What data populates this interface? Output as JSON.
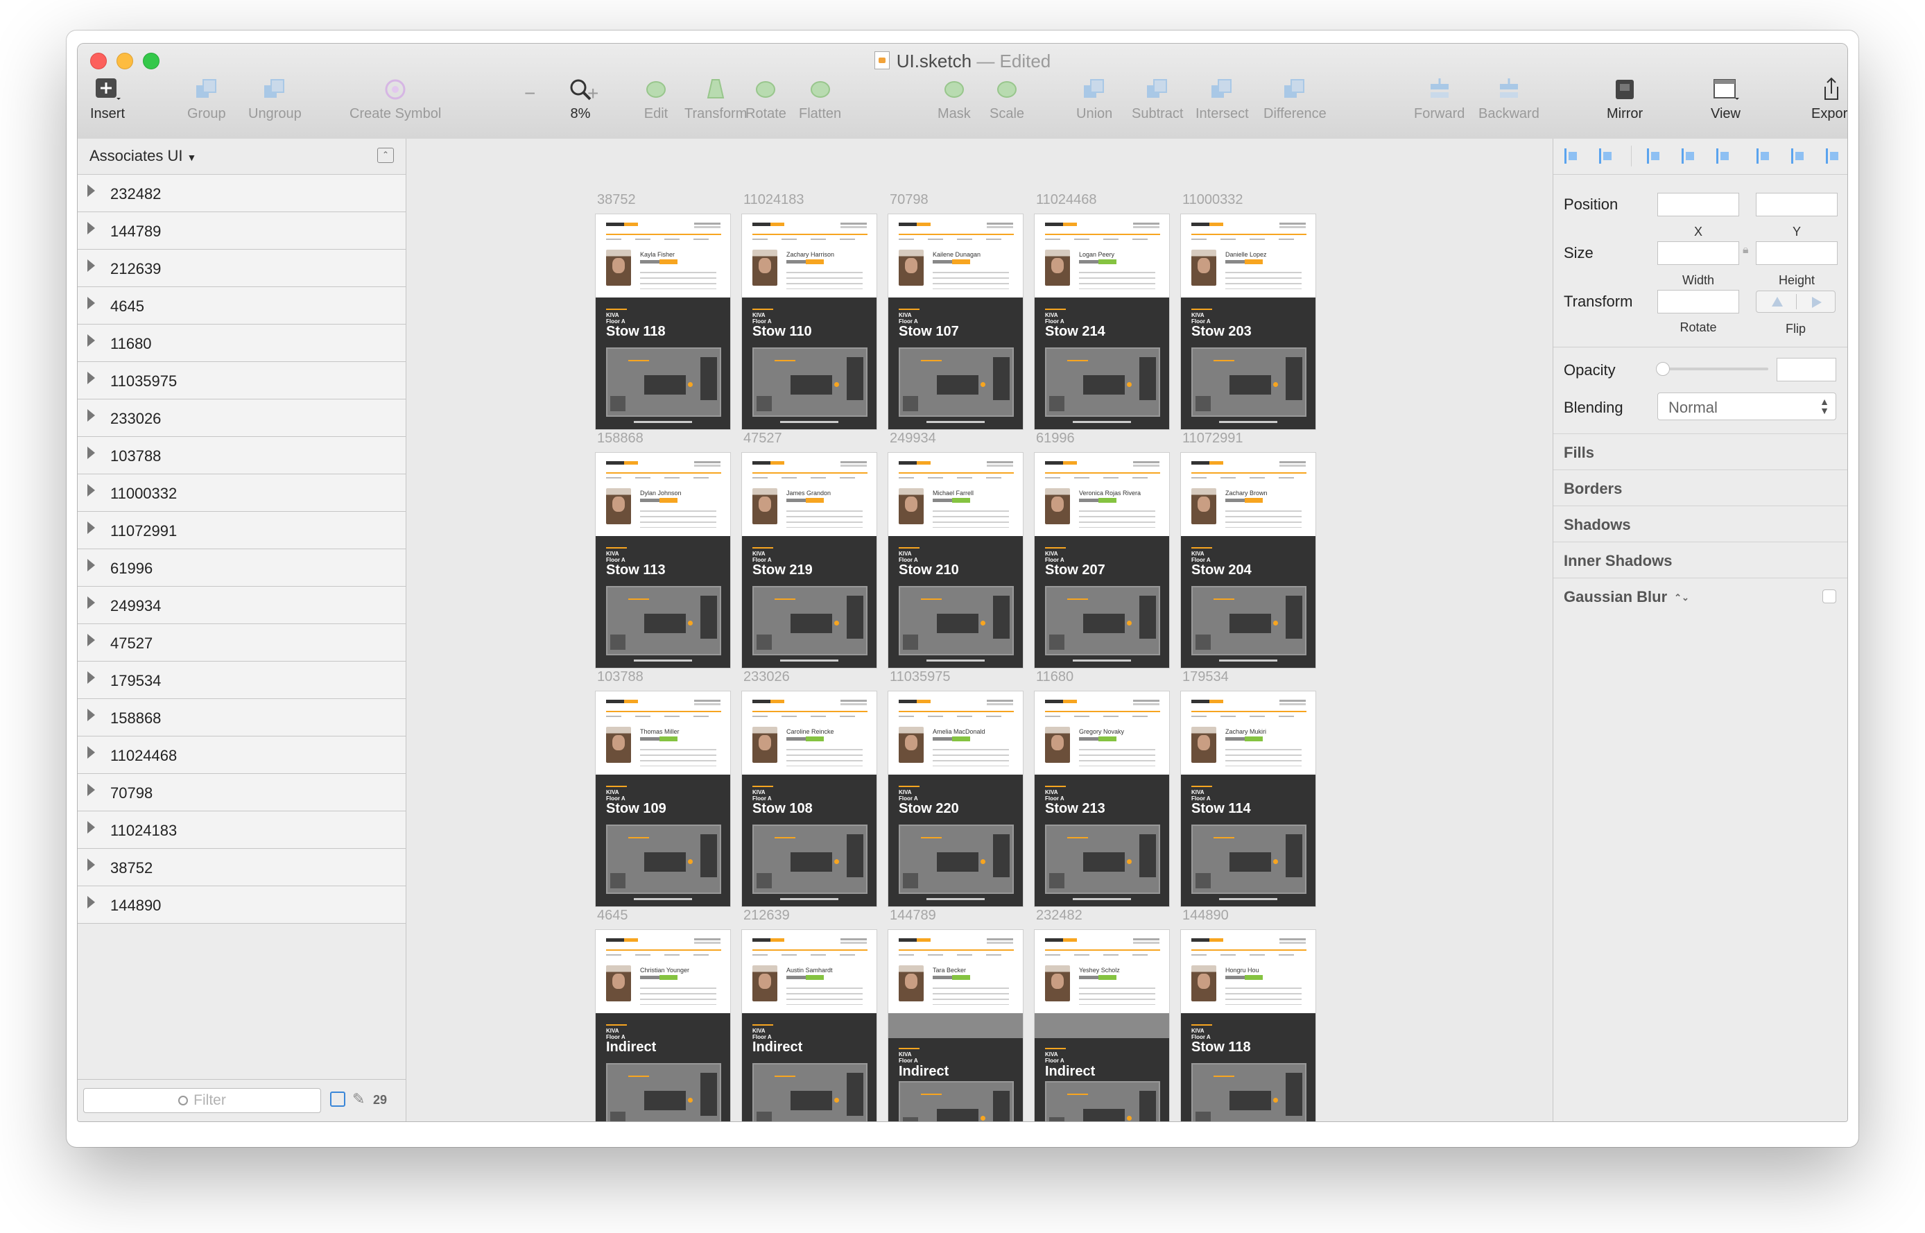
{
  "window": {
    "title": "UI.sketch",
    "title_separator": "—",
    "title_status": "Edited"
  },
  "toolbar": {
    "items": [
      {
        "label": "Insert",
        "icon": "insert-plus-icon",
        "enabled": true
      },
      {
        "label": "Group",
        "icon": "group-icon",
        "enabled": false
      },
      {
        "label": "Ungroup",
        "icon": "ungroup-icon",
        "enabled": false
      },
      {
        "label": "Create Symbol",
        "icon": "create-symbol-icon",
        "enabled": false
      },
      {
        "label": "8%",
        "icon": "zoom-icon",
        "enabled": true
      },
      {
        "label": "Edit",
        "icon": "edit-icon",
        "enabled": false
      },
      {
        "label": "Transform",
        "icon": "transform-icon",
        "enabled": false
      },
      {
        "label": "Rotate",
        "icon": "rotate-icon",
        "enabled": false
      },
      {
        "label": "Flatten",
        "icon": "flatten-icon",
        "enabled": false
      },
      {
        "label": "Mask",
        "icon": "mask-icon",
        "enabled": false
      },
      {
        "label": "Scale",
        "icon": "scale-icon",
        "enabled": false
      },
      {
        "label": "Union",
        "icon": "union-icon",
        "enabled": false
      },
      {
        "label": "Subtract",
        "icon": "subtract-icon",
        "enabled": false
      },
      {
        "label": "Intersect",
        "icon": "intersect-icon",
        "enabled": false
      },
      {
        "label": "Difference",
        "icon": "difference-icon",
        "enabled": false
      },
      {
        "label": "Forward",
        "icon": "forward-icon",
        "enabled": false
      },
      {
        "label": "Backward",
        "icon": "backward-icon",
        "enabled": false
      },
      {
        "label": "Mirror",
        "icon": "mirror-icon",
        "enabled": true
      },
      {
        "label": "View",
        "icon": "view-icon",
        "enabled": true
      },
      {
        "label": "Export",
        "icon": "export-icon",
        "enabled": true
      }
    ],
    "zoom_minus": "−",
    "zoom_plus": "+"
  },
  "sidebar": {
    "page_name": "Associates UI",
    "layers": [
      "232482",
      "144789",
      "212639",
      "4645",
      "11680",
      "11035975",
      "233026",
      "103788",
      "11000332",
      "11072991",
      "61996",
      "249934",
      "47527",
      "179534",
      "158868",
      "11024468",
      "70798",
      "11024183",
      "38752",
      "144890"
    ],
    "filter_placeholder": "Filter",
    "count": "29"
  },
  "artboards": [
    {
      "label": "38752",
      "name": "Kayla Fisher",
      "station": "Stow 118",
      "badge": "orange"
    },
    {
      "label": "11024183",
      "name": "Zachary Harrison",
      "station": "Stow 110",
      "badge": "orange"
    },
    {
      "label": "70798",
      "name": "Kailene Dunagan",
      "station": "Stow 107",
      "badge": "orange"
    },
    {
      "label": "11024468",
      "name": "Logan Peery",
      "station": "Stow 214",
      "badge": "green"
    },
    {
      "label": "11000332",
      "name": "Danielle Lopez",
      "station": "Stow 203",
      "badge": "orange"
    },
    {
      "label": "158868",
      "name": "Dylan Johnson",
      "station": "Stow 113",
      "badge": "orange"
    },
    {
      "label": "47527",
      "name": "James Grandon",
      "station": "Stow 219",
      "badge": "orange"
    },
    {
      "label": "249934",
      "name": "Michael Farrell",
      "station": "Stow 210",
      "badge": "green"
    },
    {
      "label": "61996",
      "name": "Veronica Rojas Rivera",
      "station": "Stow 207",
      "badge": "green"
    },
    {
      "label": "11072991",
      "name": "Zachary Brown",
      "station": "Stow 204",
      "badge": "orange"
    },
    {
      "label": "103788",
      "name": "Thomas Miller",
      "station": "Stow 109",
      "badge": "green"
    },
    {
      "label": "233026",
      "name": "Caroline Reincke",
      "station": "Stow 108",
      "badge": "green"
    },
    {
      "label": "11035975",
      "name": "Amelia MacDonald",
      "station": "Stow 220",
      "badge": "green"
    },
    {
      "label": "11680",
      "name": "Gregory Novaky",
      "station": "Stow 213",
      "badge": "green"
    },
    {
      "label": "179534",
      "name": "Zachary Mukiri",
      "station": "Stow 114",
      "badge": "green"
    },
    {
      "label": "4645",
      "name": "Christian Younger",
      "station": "Indirect",
      "badge": "green"
    },
    {
      "label": "212639",
      "name": "Austin Samhardt",
      "station": "Indirect",
      "badge": "green"
    },
    {
      "label": "144789",
      "name": "Tara Becker",
      "station": "Indirect",
      "badge": "green",
      "grey_banner": true
    },
    {
      "label": "232482",
      "name": "Yeshey Scholz",
      "station": "Indirect",
      "badge": "green",
      "grey_banner": true
    },
    {
      "label": "144890",
      "name": "Hongru Hou",
      "station": "Stow 118",
      "badge": "green"
    }
  ],
  "artboard_header": {
    "floor_line1": "KIVA",
    "floor_line2": "Floor A"
  },
  "inspector": {
    "position_label": "Position",
    "x_label": "X",
    "y_label": "Y",
    "size_label": "Size",
    "width_label": "Width",
    "height_label": "Height",
    "transform_label": "Transform",
    "rotate_label": "Rotate",
    "flip_label": "Flip",
    "opacity_label": "Opacity",
    "blending_label": "Blending",
    "blending_value": "Normal",
    "sections": [
      "Fills",
      "Borders",
      "Shadows",
      "Inner Shadows",
      "Gaussian Blur"
    ]
  },
  "colors": {
    "accent_orange": "#f7a520",
    "accent_green": "#85c341",
    "selection_blue": "#3a86d8"
  }
}
